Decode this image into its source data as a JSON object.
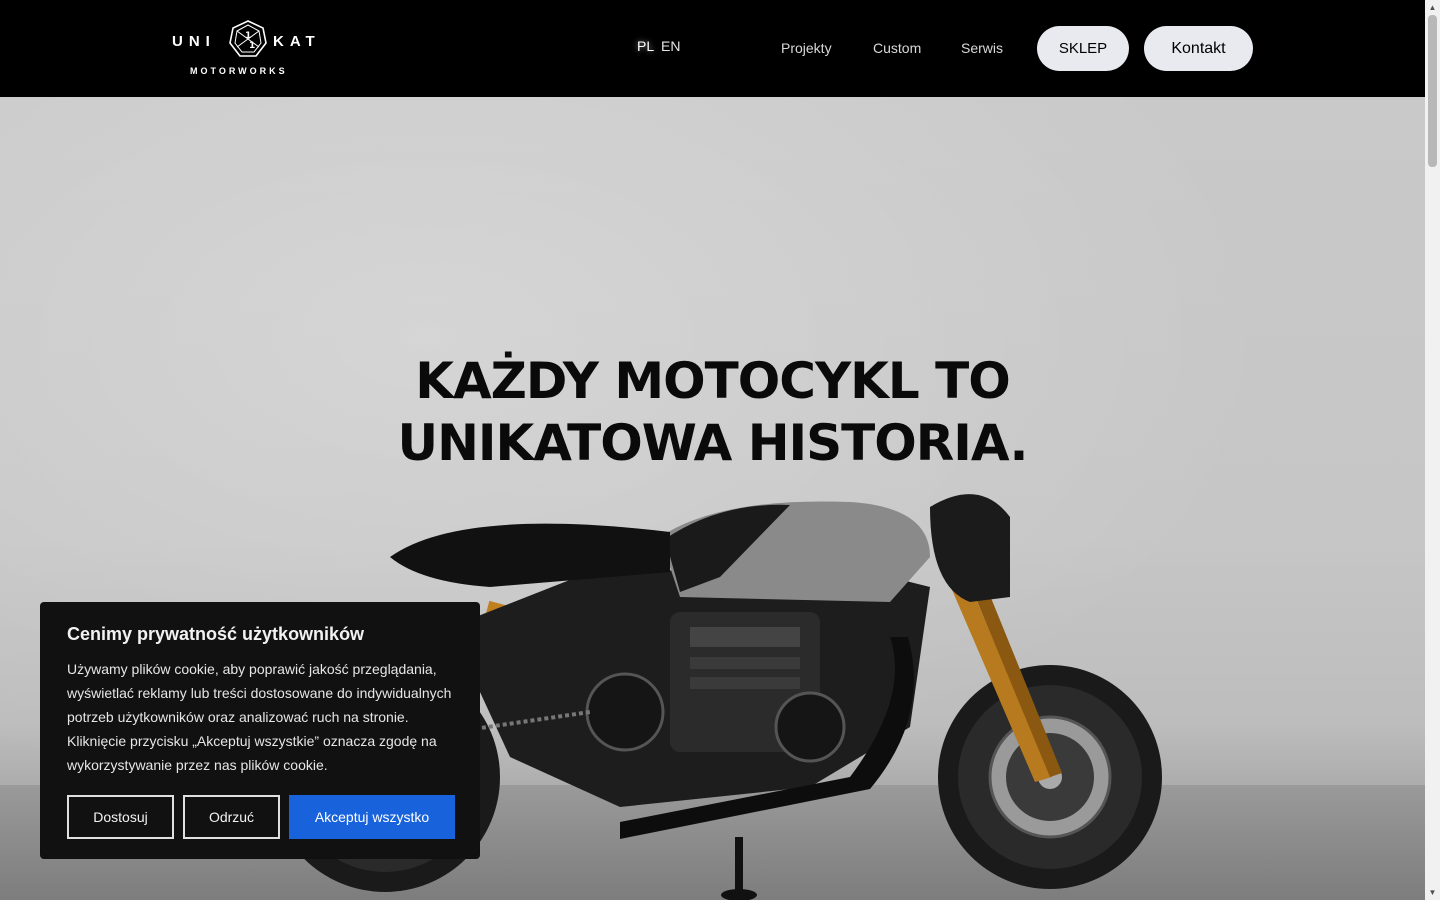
{
  "header": {
    "logo": {
      "left_text": "UNI",
      "right_text": "KAT",
      "sub_text": "MOTORWORKS"
    },
    "languages": [
      "PL",
      "EN"
    ],
    "nav": {
      "projekty": "Projekty",
      "custom": "Custom",
      "serwis": "Serwis"
    },
    "buttons": {
      "sklep": "SKLEP",
      "kontakt": "Kontakt"
    }
  },
  "hero": {
    "headline_line1": "KAŻDY MOTOCYKL TO",
    "headline_line2": "UNIKATOWA HISTORIA.",
    "image": "motorcycle-photo"
  },
  "cookie_banner": {
    "title": "Cenimy prywatność użytkowników",
    "text": "Używamy plików cookie, aby poprawić jakość przeglądania, wyświetlać reklamy lub treści dostosowane do indywidualnych potrzeb użytkowników oraz analizować ruch na stronie. Kliknięcie przycisku „Akceptuj wszystkie” oznacza zgodę na wykorzystywanie przez nas plików cookie.",
    "customize_label": "Dostosuj",
    "reject_label": "Odrzuć",
    "accept_label": "Akceptuj wszystko",
    "accept_color": "#1863dc"
  },
  "colors": {
    "header_bg": "#000000",
    "pill_bg": "#e8eaf0",
    "panel_bg": "#111111"
  }
}
